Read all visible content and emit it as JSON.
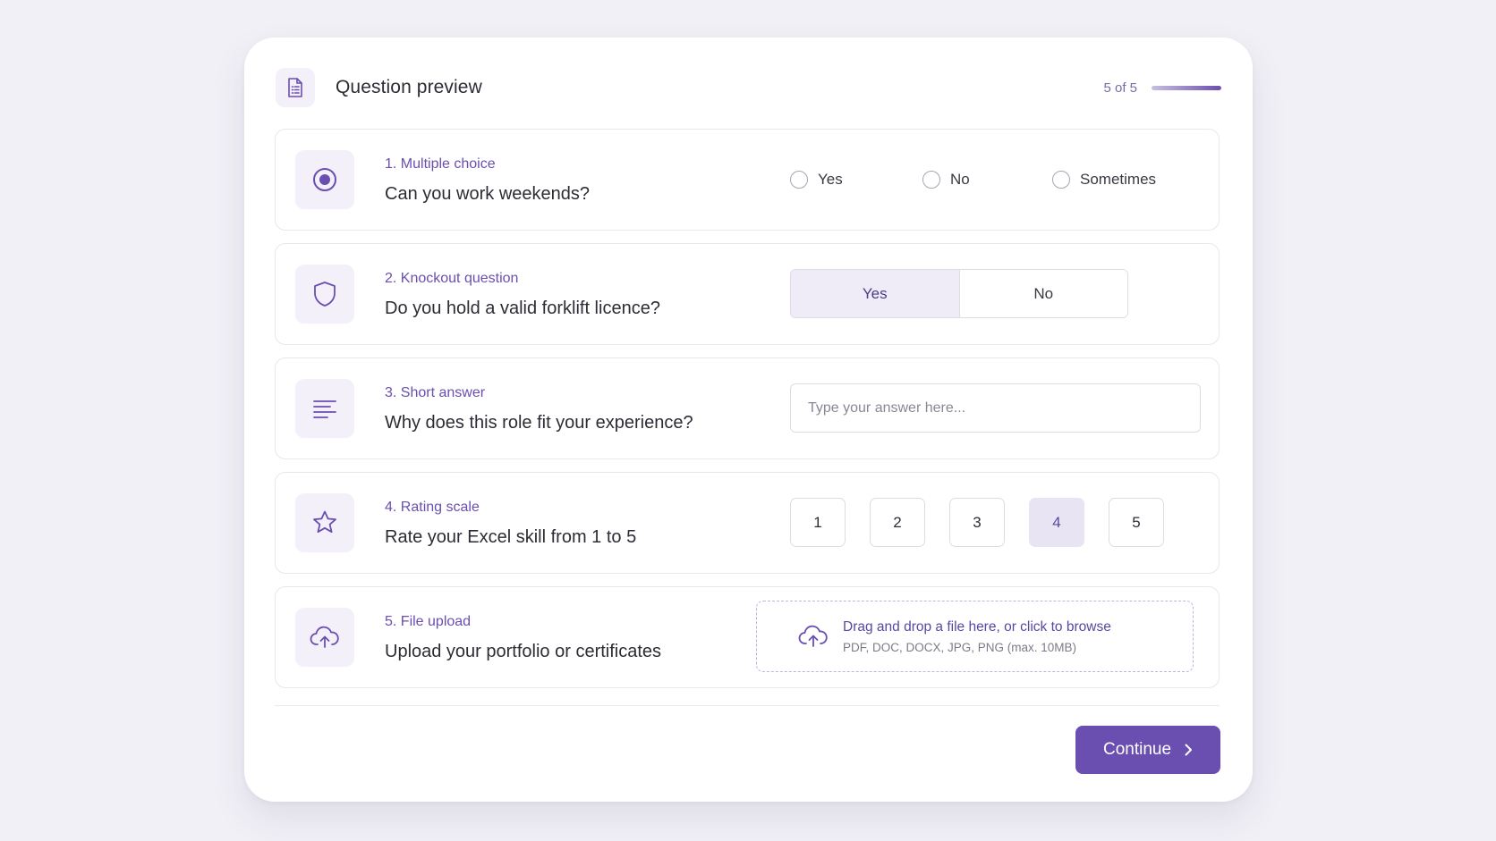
{
  "header": {
    "title": "Question preview",
    "progress_text": "5 of 5",
    "progress_fraction": 1.0,
    "icon": "document-list-icon"
  },
  "questions": [
    {
      "label": "1. Multiple choice",
      "text": "Can you work weekends?",
      "icon": "radio-button-icon",
      "type": "multiple_choice",
      "options": [
        "Yes",
        "No",
        "Sometimes"
      ]
    },
    {
      "label": "2. Knockout question",
      "text": "Do you hold a valid forklift licence?",
      "icon": "shield-icon",
      "type": "knockout",
      "options": [
        "Yes",
        "No"
      ],
      "selected": "Yes"
    },
    {
      "label": "3. Short answer",
      "text": "Why does this role fit your experience?",
      "icon": "text-lines-icon",
      "type": "short_answer",
      "placeholder": "Type your answer here..."
    },
    {
      "label": "4. Rating scale",
      "text": "Rate your Excel skill from 1 to 5",
      "icon": "star-icon",
      "type": "rating",
      "options": [
        "1",
        "2",
        "3",
        "4",
        "5"
      ],
      "selected": "4"
    },
    {
      "label": "5. File upload",
      "text": "Upload your portfolio or certificates",
      "icon": "cloud-upload-icon",
      "type": "file_upload",
      "drop_text": "Drag and drop a file here, or click to browse",
      "drop_hint": "PDF, DOC, DOCX, JPG, PNG (max. 10MB)"
    }
  ],
  "footer": {
    "continue_label": "Continue"
  },
  "colors": {
    "accent": "#6a4fb0",
    "accent_soft": "#f3f0fa",
    "background": "#f1f0f6",
    "border": "#e8e6ef"
  }
}
